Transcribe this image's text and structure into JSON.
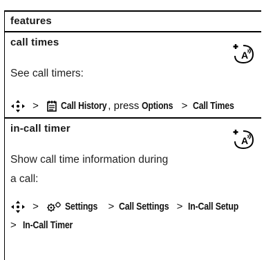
{
  "header": {
    "title": "features"
  },
  "sections": [
    {
      "title": "call times",
      "description": "See call timers:",
      "path": {
        "sep": ">",
        "menu_label": "Call History",
        "mid_text": ", press",
        "options_label": "Options",
        "end_label": "Call Times"
      },
      "badge_icon": "network-feature-icon",
      "badge_text": "A"
    },
    {
      "title": "in-call timer",
      "description_line1": "Show call time information during",
      "description_line2": "a call:",
      "path": {
        "sep": ">",
        "menu_label": "Settings",
        "step2": "Call Settings",
        "step3": "In-Call Setup",
        "step4": "In-Call Timer"
      },
      "badge_icon": "network-feature-icon",
      "badge_text": "A"
    }
  ]
}
